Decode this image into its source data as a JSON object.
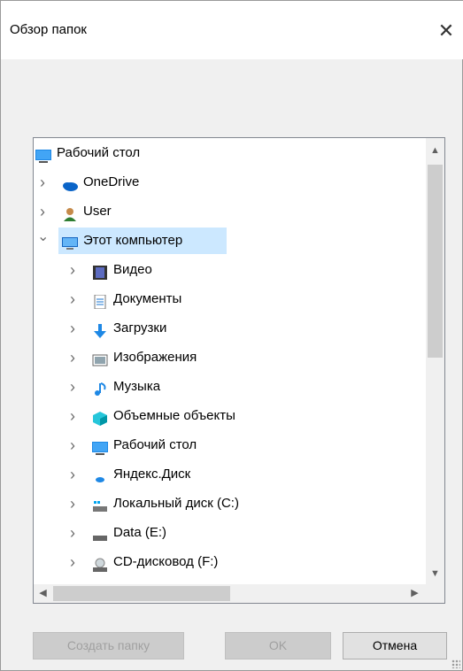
{
  "window": {
    "title": "Обзор папок",
    "close_glyph": "✕"
  },
  "tree": {
    "items": [
      {
        "label": "Рабочий стол",
        "icon": "desktop-icon",
        "expander": "",
        "level": 0
      },
      {
        "label": "OneDrive",
        "icon": "onedrive-cloud-icon",
        "expander": ">",
        "level": 0
      },
      {
        "label": "User",
        "icon": "user-icon",
        "expander": ">",
        "level": 0
      },
      {
        "label": "Этот компьютер",
        "icon": "computer-icon",
        "expander": "v",
        "level": 0,
        "selected": true
      },
      {
        "label": "Видео",
        "icon": "video-icon",
        "expander": ">",
        "level": 1
      },
      {
        "label": "Документы",
        "icon": "documents-icon",
        "expander": ">",
        "level": 1
      },
      {
        "label": "Загрузки",
        "icon": "downloads-icon",
        "expander": ">",
        "level": 1
      },
      {
        "label": "Изображения",
        "icon": "pictures-icon",
        "expander": ">",
        "level": 1
      },
      {
        "label": "Музыка",
        "icon": "music-icon",
        "expander": ">",
        "level": 1
      },
      {
        "label": "Объемные объекты",
        "icon": "3d-objects-icon",
        "expander": ">",
        "level": 1
      },
      {
        "label": "Рабочий стол",
        "icon": "desktop-icon",
        "expander": ">",
        "level": 1
      },
      {
        "label": "Яндекс.Диск",
        "icon": "yandex-disk-icon",
        "expander": ">",
        "level": 1
      },
      {
        "label": "Локальный диск (C:)",
        "icon": "local-disk-icon",
        "expander": ">",
        "level": 1
      },
      {
        "label": "Data (E:)",
        "icon": "drive-icon",
        "expander": ">",
        "level": 1
      },
      {
        "label": "CD-дисковод (F:)",
        "icon": "cd-drive-icon",
        "expander": ">",
        "level": 1
      }
    ]
  },
  "buttons": {
    "new_folder": "Создать папку",
    "ok": "OK",
    "cancel": "Отмена"
  },
  "colors": {
    "selection": "#cce8ff",
    "accent": "#0078d7"
  }
}
